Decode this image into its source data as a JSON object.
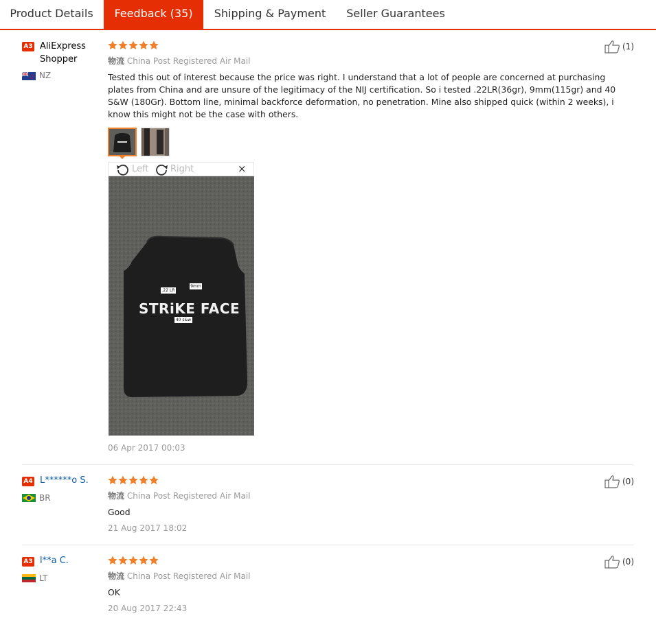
{
  "tabs": [
    {
      "label": "Product Details",
      "active": false
    },
    {
      "label": "Feedback (35)",
      "active": true
    },
    {
      "label": "Shipping & Payment",
      "active": false
    },
    {
      "label": "Seller Guarantees",
      "active": false
    }
  ],
  "colors": {
    "accent": "#e62e04",
    "star": "#f08029",
    "link": "#0b5ba8"
  },
  "reviews": [
    {
      "level": "A3",
      "user": "AliExpress Shopper",
      "country": "NZ",
      "flag": "nz-flag",
      "rating": 5,
      "logistics_cn": "物流",
      "logistics": "China Post Registered Air Mail",
      "text": "Tested this out of interest because the price was right. I understand that a lot of people are concerned at purchasing plates from China and are unsure of the legitimacy of the NIJ certification. So i tested .22LR(36gr), 9mm(115gr) and 40 S&W (180Gr). Bottom line, minimal backforce deformation, no penetration. Mine also shipped quick (within 2 weeks), i know this might not be the case with others.",
      "likes": "(1)",
      "date": "06 Apr 2017 00:03",
      "viewer": {
        "left": "Left",
        "right": "Right",
        "close": "×"
      },
      "photo_text": {
        "main": "STRiKE FACE",
        "l1": ".22 LR",
        "l2": "9mm",
        "l3": "40 s&w"
      }
    },
    {
      "level": "A4",
      "user": "L******o S.",
      "country": "BR",
      "flag": "br-flag",
      "rating": 5,
      "logistics_cn": "物流",
      "logistics": "China Post Registered Air Mail",
      "text": "Good",
      "likes": "(0)",
      "date": "21 Aug 2017 18:02"
    },
    {
      "level": "A3",
      "user": "l**a C.",
      "country": "LT",
      "flag": "lt-flag",
      "rating": 5,
      "logistics_cn": "物流",
      "logistics": "China Post Registered Air Mail",
      "text": "OK",
      "likes": "(0)",
      "date": "20 Aug 2017 22:43"
    }
  ]
}
